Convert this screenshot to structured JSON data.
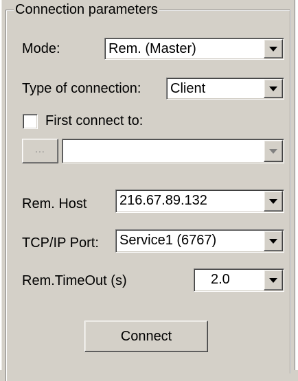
{
  "group": {
    "title": "Connection parameters"
  },
  "mode": {
    "label": "Mode:",
    "value": "Rem. (Master)"
  },
  "connection_type": {
    "label": "Type of connection:",
    "value": "Client"
  },
  "first_connect": {
    "label": "First connect to:",
    "checked": false,
    "button_label": "...",
    "value": ""
  },
  "rem_host": {
    "label": "Rem. Host",
    "value": "216.67.89.132"
  },
  "tcp_port": {
    "label": "TCP/IP Port:",
    "value": "Service1 (6767)"
  },
  "timeout": {
    "label": "Rem.TimeOut (s)",
    "value": "2.0"
  },
  "connect_button": {
    "label": "Connect"
  },
  "icons": {
    "dropdown": "chevron-down-icon"
  },
  "colors": {
    "face": "#d4d0c8",
    "shadow": "#808080",
    "highlight": "#ffffff"
  }
}
